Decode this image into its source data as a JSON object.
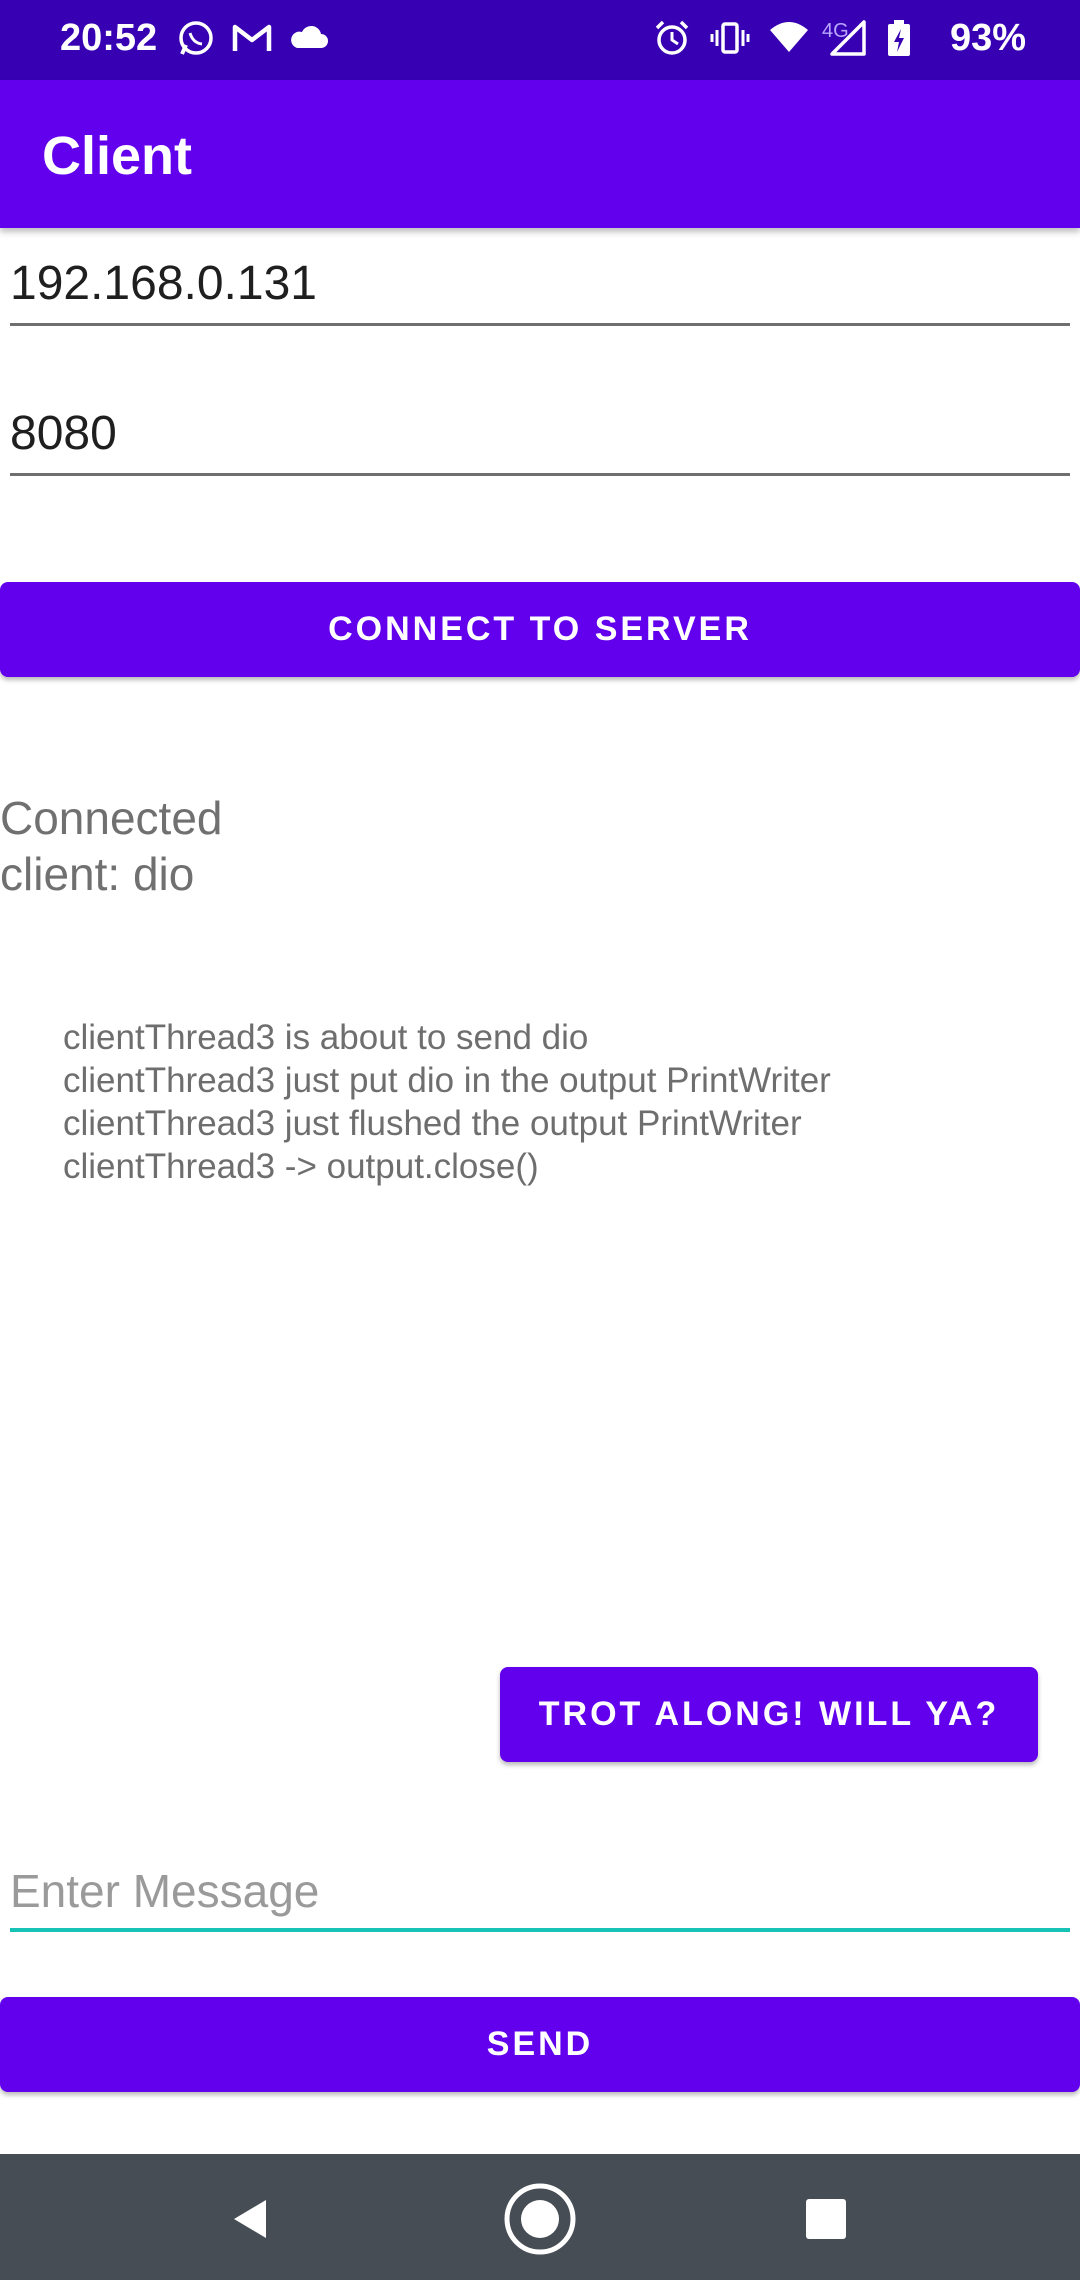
{
  "status_bar": {
    "time": "20:52",
    "left_icons": [
      "whatsapp-icon",
      "gmail-icon",
      "cloud-icon"
    ],
    "right_icons": [
      "alarm-icon",
      "vibrate-icon",
      "wifi-icon",
      "signal-icon",
      "battery-charging-icon"
    ],
    "network": "4G",
    "battery": "93%"
  },
  "app_bar": {
    "title": "Client"
  },
  "form": {
    "ip_value": "192.168.0.131",
    "port_value": "8080"
  },
  "buttons": {
    "connect": "CONNECT TO SERVER",
    "trot": "TROT ALONG! WILL YA?",
    "send": "SEND"
  },
  "status": {
    "line1": "Connected",
    "line2": "client: dio"
  },
  "log_lines": [
    "clientThread3 is about to send dio",
    "clientThread3 just put dio in the output PrintWriter",
    "clientThread3 just flushed the output PrintWriter",
    "clientThread3 -> output.close()"
  ],
  "message": {
    "placeholder": "Enter Message"
  },
  "nav": [
    "back-icon",
    "home-icon",
    "recents-icon"
  ],
  "colors": {
    "status_bar": "#3700b3",
    "primary": "#6200ee",
    "accent_underline": "#18c2b6",
    "nav_bar": "#474d55"
  }
}
